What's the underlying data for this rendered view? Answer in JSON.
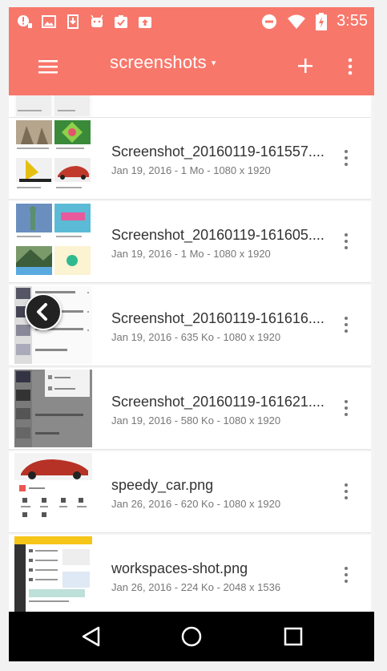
{
  "status_bar": {
    "time": "3:55",
    "left_icons": [
      "notification-alert-icon",
      "image-icon",
      "download-icon",
      "android-icon",
      "task-check-icon",
      "camera-upload-icon"
    ],
    "right_icons": [
      "do-not-disturb-icon",
      "wifi-icon",
      "battery-charging-icon"
    ]
  },
  "app_bar": {
    "title": "screenshots",
    "caret": "▾",
    "background": "#f8776b",
    "icons": [
      "menu-icon",
      "add-icon",
      "more-vert-icon"
    ]
  },
  "files": [
    {
      "name": "Screenshot_20160119-161557....",
      "date": "Jan 19, 2016",
      "size": "1 Mo",
      "dimensions": "1080 x 1920"
    },
    {
      "name": "Screenshot_20160119-161605....",
      "date": "Jan 19, 2016",
      "size": "1 Mo",
      "dimensions": "1080 x 1920"
    },
    {
      "name": "Screenshot_20160119-161616....",
      "date": "Jan 19, 2016",
      "size": "635 Ko",
      "dimensions": "1080 x 1920"
    },
    {
      "name": "Screenshot_20160119-161621....",
      "date": "Jan 19, 2016",
      "size": "580 Ko",
      "dimensions": "1080 x 1920"
    },
    {
      "name": "speedy_car.png",
      "date": "Jan 26, 2016",
      "size": "620 Ko",
      "dimensions": "1080 x 1920"
    },
    {
      "name": "workspaces-shot.png",
      "date": "Jan 26, 2016",
      "size": "224 Ko",
      "dimensions": "2048 x 1536"
    }
  ],
  "meta_separator": " - ",
  "nav_bar": {
    "icons": [
      "back-triangle-icon",
      "home-circle-icon",
      "recents-square-icon"
    ]
  },
  "overlay": {
    "icon": "chevron-left-icon"
  }
}
